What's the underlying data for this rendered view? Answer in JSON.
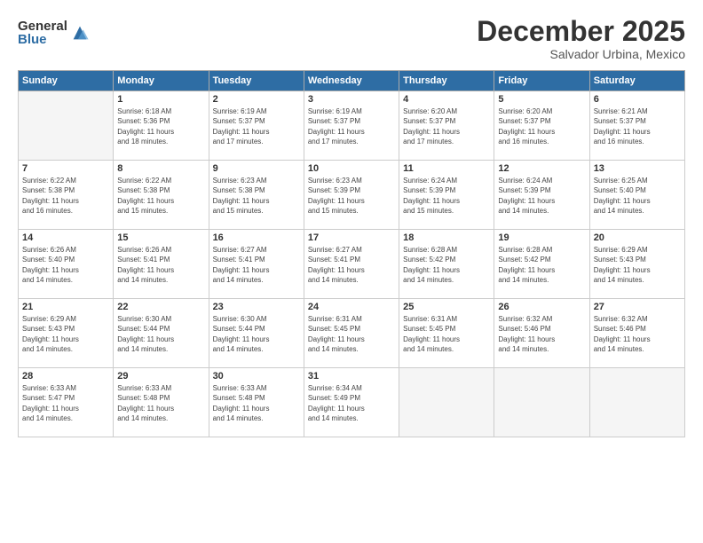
{
  "header": {
    "logo_general": "General",
    "logo_blue": "Blue",
    "month_title": "December 2025",
    "subtitle": "Salvador Urbina, Mexico"
  },
  "weekdays": [
    "Sunday",
    "Monday",
    "Tuesday",
    "Wednesday",
    "Thursday",
    "Friday",
    "Saturday"
  ],
  "weeks": [
    [
      {
        "day": "",
        "info": ""
      },
      {
        "day": "1",
        "info": "Sunrise: 6:18 AM\nSunset: 5:36 PM\nDaylight: 11 hours\nand 18 minutes."
      },
      {
        "day": "2",
        "info": "Sunrise: 6:19 AM\nSunset: 5:37 PM\nDaylight: 11 hours\nand 17 minutes."
      },
      {
        "day": "3",
        "info": "Sunrise: 6:19 AM\nSunset: 5:37 PM\nDaylight: 11 hours\nand 17 minutes."
      },
      {
        "day": "4",
        "info": "Sunrise: 6:20 AM\nSunset: 5:37 PM\nDaylight: 11 hours\nand 17 minutes."
      },
      {
        "day": "5",
        "info": "Sunrise: 6:20 AM\nSunset: 5:37 PM\nDaylight: 11 hours\nand 16 minutes."
      },
      {
        "day": "6",
        "info": "Sunrise: 6:21 AM\nSunset: 5:37 PM\nDaylight: 11 hours\nand 16 minutes."
      }
    ],
    [
      {
        "day": "7",
        "info": "Sunrise: 6:22 AM\nSunset: 5:38 PM\nDaylight: 11 hours\nand 16 minutes."
      },
      {
        "day": "8",
        "info": "Sunrise: 6:22 AM\nSunset: 5:38 PM\nDaylight: 11 hours\nand 15 minutes."
      },
      {
        "day": "9",
        "info": "Sunrise: 6:23 AM\nSunset: 5:38 PM\nDaylight: 11 hours\nand 15 minutes."
      },
      {
        "day": "10",
        "info": "Sunrise: 6:23 AM\nSunset: 5:39 PM\nDaylight: 11 hours\nand 15 minutes."
      },
      {
        "day": "11",
        "info": "Sunrise: 6:24 AM\nSunset: 5:39 PM\nDaylight: 11 hours\nand 15 minutes."
      },
      {
        "day": "12",
        "info": "Sunrise: 6:24 AM\nSunset: 5:39 PM\nDaylight: 11 hours\nand 14 minutes."
      },
      {
        "day": "13",
        "info": "Sunrise: 6:25 AM\nSunset: 5:40 PM\nDaylight: 11 hours\nand 14 minutes."
      }
    ],
    [
      {
        "day": "14",
        "info": "Sunrise: 6:26 AM\nSunset: 5:40 PM\nDaylight: 11 hours\nand 14 minutes."
      },
      {
        "day": "15",
        "info": "Sunrise: 6:26 AM\nSunset: 5:41 PM\nDaylight: 11 hours\nand 14 minutes."
      },
      {
        "day": "16",
        "info": "Sunrise: 6:27 AM\nSunset: 5:41 PM\nDaylight: 11 hours\nand 14 minutes."
      },
      {
        "day": "17",
        "info": "Sunrise: 6:27 AM\nSunset: 5:41 PM\nDaylight: 11 hours\nand 14 minutes."
      },
      {
        "day": "18",
        "info": "Sunrise: 6:28 AM\nSunset: 5:42 PM\nDaylight: 11 hours\nand 14 minutes."
      },
      {
        "day": "19",
        "info": "Sunrise: 6:28 AM\nSunset: 5:42 PM\nDaylight: 11 hours\nand 14 minutes."
      },
      {
        "day": "20",
        "info": "Sunrise: 6:29 AM\nSunset: 5:43 PM\nDaylight: 11 hours\nand 14 minutes."
      }
    ],
    [
      {
        "day": "21",
        "info": "Sunrise: 6:29 AM\nSunset: 5:43 PM\nDaylight: 11 hours\nand 14 minutes."
      },
      {
        "day": "22",
        "info": "Sunrise: 6:30 AM\nSunset: 5:44 PM\nDaylight: 11 hours\nand 14 minutes."
      },
      {
        "day": "23",
        "info": "Sunrise: 6:30 AM\nSunset: 5:44 PM\nDaylight: 11 hours\nand 14 minutes."
      },
      {
        "day": "24",
        "info": "Sunrise: 6:31 AM\nSunset: 5:45 PM\nDaylight: 11 hours\nand 14 minutes."
      },
      {
        "day": "25",
        "info": "Sunrise: 6:31 AM\nSunset: 5:45 PM\nDaylight: 11 hours\nand 14 minutes."
      },
      {
        "day": "26",
        "info": "Sunrise: 6:32 AM\nSunset: 5:46 PM\nDaylight: 11 hours\nand 14 minutes."
      },
      {
        "day": "27",
        "info": "Sunrise: 6:32 AM\nSunset: 5:46 PM\nDaylight: 11 hours\nand 14 minutes."
      }
    ],
    [
      {
        "day": "28",
        "info": "Sunrise: 6:33 AM\nSunset: 5:47 PM\nDaylight: 11 hours\nand 14 minutes."
      },
      {
        "day": "29",
        "info": "Sunrise: 6:33 AM\nSunset: 5:48 PM\nDaylight: 11 hours\nand 14 minutes."
      },
      {
        "day": "30",
        "info": "Sunrise: 6:33 AM\nSunset: 5:48 PM\nDaylight: 11 hours\nand 14 minutes."
      },
      {
        "day": "31",
        "info": "Sunrise: 6:34 AM\nSunset: 5:49 PM\nDaylight: 11 hours\nand 14 minutes."
      },
      {
        "day": "",
        "info": ""
      },
      {
        "day": "",
        "info": ""
      },
      {
        "day": "",
        "info": ""
      }
    ]
  ]
}
